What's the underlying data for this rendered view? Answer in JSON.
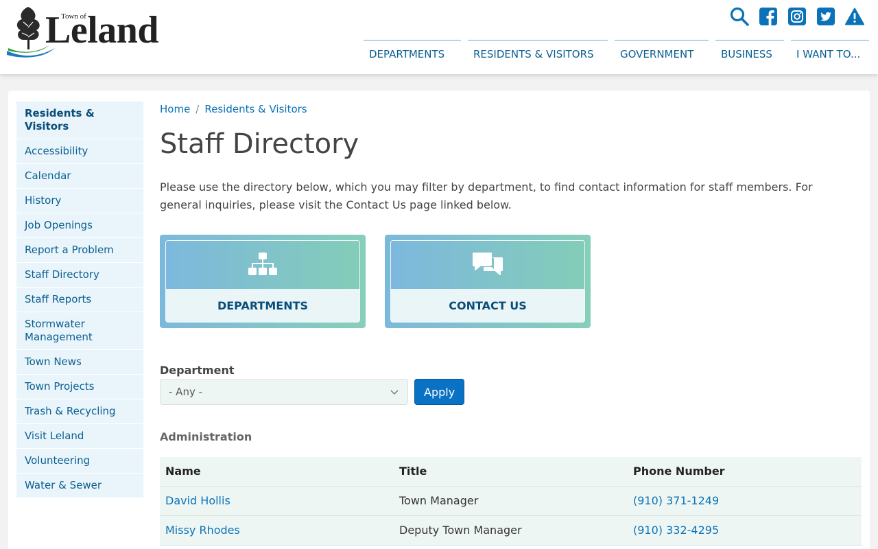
{
  "header": {
    "logo": {
      "small_text": "Town of",
      "name": "Leland"
    },
    "icons": [
      "search-icon",
      "facebook-icon",
      "instagram-icon",
      "twitter-icon",
      "alert-icon"
    ],
    "nav": [
      "DEPARTMENTS",
      "RESIDENTS & VISITORS",
      "GOVERNMENT",
      "BUSINESS",
      "I WANT TO..."
    ]
  },
  "sidebar": {
    "heading": "Residents & Visitors",
    "items": [
      "Accessibility",
      "Calendar",
      "History",
      "Job Openings",
      "Report a Problem",
      "Staff Directory",
      "Staff Reports",
      "Stormwater Management",
      "Town News",
      "Town Projects",
      "Trash & Recycling",
      "Visit Leland",
      "Volunteering",
      "Water & Sewer"
    ]
  },
  "breadcrumb": {
    "home": "Home",
    "separator": "/",
    "current": "Residents & Visitors"
  },
  "page": {
    "title": "Staff Directory",
    "intro": "Please use the directory below, which you may filter by department, to find contact information for staff members. For general inquiries, please visit the Contact Us page linked below."
  },
  "tiles": [
    {
      "label": "DEPARTMENTS",
      "icon": "org-chart-icon"
    },
    {
      "label": "CONTACT US",
      "icon": "chat-bubbles-icon"
    }
  ],
  "filter": {
    "label": "Department",
    "selected": "- Any -",
    "apply_label": "Apply"
  },
  "directory": {
    "section": "Administration",
    "columns": [
      "Name",
      "Title",
      "Phone Number"
    ],
    "rows": [
      {
        "name": "David Hollis",
        "title": "Town Manager",
        "phone": "(910) 371-1249"
      },
      {
        "name": "Missy Rhodes",
        "title": "Deputy Town Manager",
        "phone": "(910) 332-4295"
      }
    ]
  },
  "colors": {
    "link": "#0a72b8",
    "nav": "#0a5f91",
    "button": "#0a72c4",
    "sidebar_bg": "#eaf5fb",
    "table_bg": "#eef6f3"
  }
}
